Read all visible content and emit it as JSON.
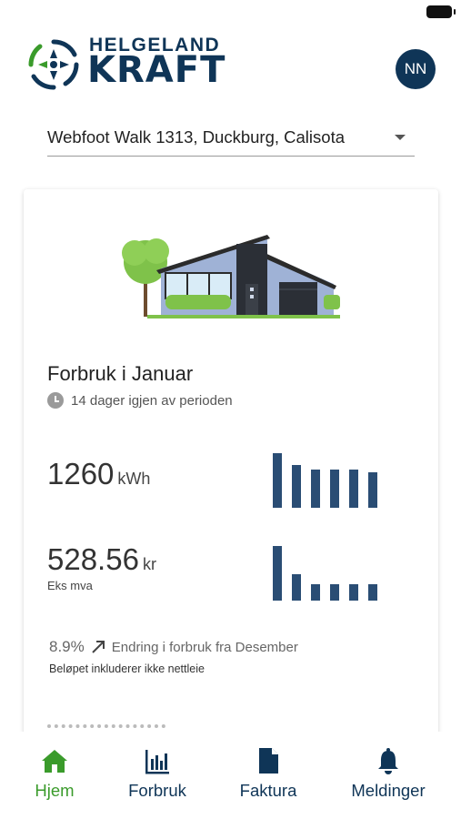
{
  "app": {
    "brand_top": "HELGELAND",
    "brand_main": "KRAFT",
    "avatar_initials": "NN"
  },
  "address": {
    "selected": "Webfoot Walk 1313, Duckburg, Calisota"
  },
  "consumption_card": {
    "title": "Forbruk i Januar",
    "period_remaining": "14 dager igjen av perioden",
    "energy": {
      "value": "1260",
      "unit": "kWh",
      "trend": [
        1.0,
        0.78,
        0.7,
        0.7,
        0.7,
        0.65
      ]
    },
    "cost": {
      "value": "528.56",
      "unit": "kr",
      "sub": "Eks mva",
      "trend": [
        1.0,
        0.48,
        0.3,
        0.3,
        0.3,
        0.3
      ]
    },
    "change": {
      "percent": "8.9%",
      "text": "Endring i forbruk fra Desember"
    },
    "note": "Beløpet inkluderer ikke nettleie"
  },
  "nav": {
    "items": [
      {
        "label": "Hjem",
        "icon": "home-icon",
        "active": true
      },
      {
        "label": "Forbruk",
        "icon": "bar-chart-icon",
        "active": false
      },
      {
        "label": "Faktura",
        "icon": "document-icon",
        "active": false
      },
      {
        "label": "Meldinger",
        "icon": "bell-icon",
        "active": false
      }
    ]
  },
  "colors": {
    "navy": "#0f3557",
    "green": "#3a9b2b",
    "bar": "#2a4d74"
  }
}
